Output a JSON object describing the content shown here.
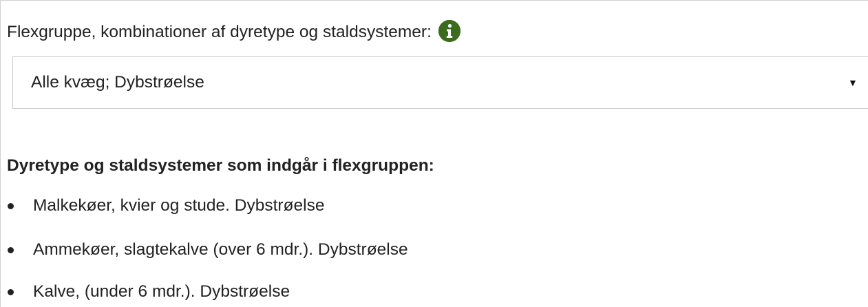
{
  "form": {
    "label": "Flexgruppe, kombinationer af dyretype og staldsystemer:",
    "info_icon": "info-circle-icon",
    "select": {
      "selected_value": "Alle kvæg; Dybstrøelse",
      "arrow": "▼"
    }
  },
  "section": {
    "heading": "Dyretype og staldsystemer som indgår i flexgruppen:",
    "items": [
      {
        "label": "Malkekøer, kvier og stude. Dybstrøelse"
      },
      {
        "label": "Ammekøer, slagtekalve (over 6 mdr.). Dybstrøelse"
      },
      {
        "label": "Kalve, (under 6 mdr.). Dybstrøelse"
      }
    ]
  },
  "colors": {
    "info_icon_bg": "#3a6b1e",
    "text": "#222222",
    "border": "#c8c8c8"
  }
}
